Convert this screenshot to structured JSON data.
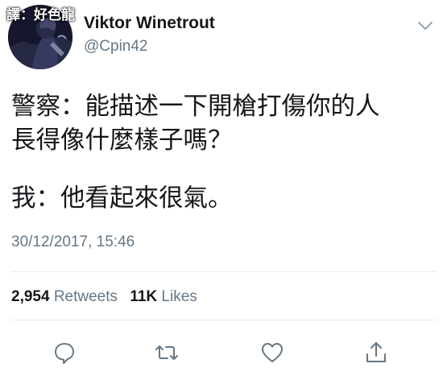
{
  "watermark": "譯：好色龍",
  "user": {
    "display_name": "Viktor Winetrout",
    "handle": "@Cpin42"
  },
  "tweet": {
    "lines_para1": [
      "警察：能描述一下開槍打傷你的人",
      "長得像什麼樣子嗎？"
    ],
    "lines_para2": [
      "我：他看起來很氣。"
    ],
    "timestamp": "30/12/2017, 15:46"
  },
  "stats": {
    "retweets_count": "2,954",
    "retweets_label": "Retweets",
    "likes_count": "11K",
    "likes_label": "Likes"
  },
  "icons": {
    "reply": "reply-icon",
    "retweet": "retweet-icon",
    "like": "like-icon",
    "share": "share-icon",
    "more": "chevron-down-icon"
  },
  "colors": {
    "text": "#14171a",
    "secondary": "#657786",
    "divider": "#e6ecf0",
    "icon": "#657786"
  }
}
